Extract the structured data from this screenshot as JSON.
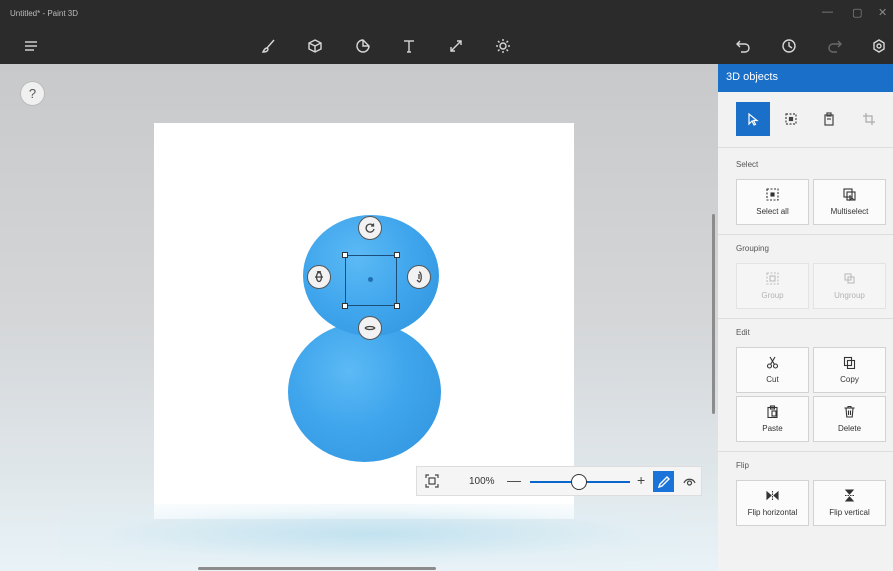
{
  "window": {
    "title": "Untitled* - Paint 3D",
    "controls": [
      "minimize-icon",
      "restore-icon",
      "close-icon"
    ]
  },
  "toolbar": {
    "left": [
      "menu-icon"
    ],
    "center": [
      "brushes-icon",
      "3d-shapes-icon",
      "stickers-icon",
      "text-icon",
      "effects-icon",
      "canvas-icon"
    ],
    "right": [
      "undo-icon",
      "history-icon",
      "redo-icon",
      "3d-library-icon"
    ]
  },
  "stage": {
    "help_label": "?"
  },
  "zoom": {
    "value": "100%",
    "minus": "—",
    "plus": "+",
    "level_fraction": 0.45
  },
  "panel": {
    "title": "3D objects",
    "modes": [
      "select-mode",
      "crop-mode",
      "paste-mode",
      "magic-select-mode"
    ],
    "sections": {
      "select": {
        "label": "Select",
        "buttons": [
          {
            "label": "Select all",
            "enabled": true
          },
          {
            "label": "Multiselect",
            "enabled": true
          }
        ]
      },
      "grouping": {
        "label": "Grouping",
        "buttons": [
          {
            "label": "Group",
            "enabled": false
          },
          {
            "label": "Ungroup",
            "enabled": false
          }
        ]
      },
      "edit": {
        "label": "Edit",
        "buttons": [
          {
            "label": "Cut",
            "enabled": true
          },
          {
            "label": "Copy",
            "enabled": true
          },
          {
            "label": "Paste",
            "enabled": true
          },
          {
            "label": "Delete",
            "enabled": true
          }
        ]
      },
      "flip": {
        "label": "Flip",
        "buttons": [
          {
            "label": "Flip horizontal",
            "enabled": true
          },
          {
            "label": "Flip vertical",
            "enabled": true
          }
        ]
      }
    }
  },
  "colors": {
    "accent": "#1a6fc9",
    "object": "#3fa5ec",
    "chrome": "#2b2b2b"
  }
}
